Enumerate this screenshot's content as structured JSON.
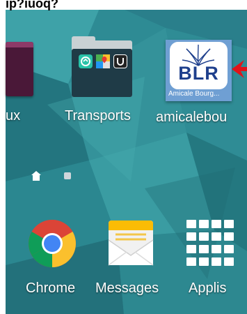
{
  "top_bar": {
    "partial_text": "ip?iuoq?"
  },
  "row1": {
    "partial_app_label": "ux",
    "folder_label": "Transports",
    "amicale_label": "amicalebou",
    "amicale_icon_text": "BLR",
    "amicale_icon_caption": "Amicale Bourg..."
  },
  "dock": {
    "chrome_label": "Chrome",
    "messages_label": "Messages",
    "applis_label": "Applis"
  },
  "colors": {
    "wallpaper": "#2f8f98",
    "arrow": "#e0141a",
    "blr_blue": "#1e3f8c"
  },
  "icons": [
    "home-page-indicator-icon",
    "page-dot-icon",
    "chrome-icon",
    "messages-envelope-icon",
    "apps-grid-icon",
    "folder-icon",
    "red-arrow-icon"
  ]
}
